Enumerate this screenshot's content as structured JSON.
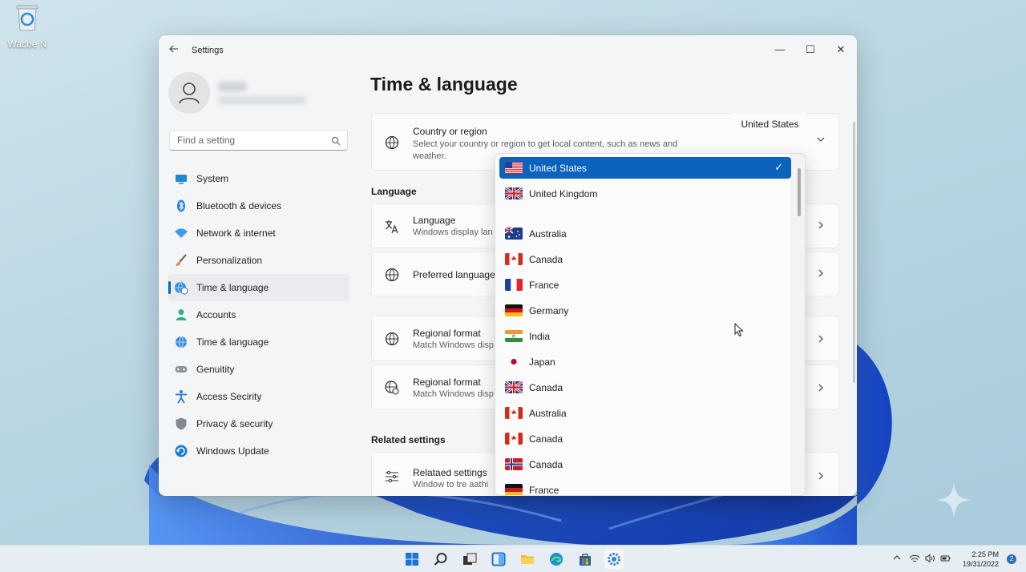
{
  "desktop": {
    "icon_label": "Wacbe N"
  },
  "window": {
    "title": "Settings",
    "controls": {
      "minimize": "—",
      "maximize": "☐",
      "close": "✕"
    }
  },
  "sidebar": {
    "search_placeholder": "Find a setting",
    "items": [
      {
        "label": "System",
        "icon": "monitor-icon"
      },
      {
        "label": "Bluetooth & devices",
        "icon": "bluetooth-icon"
      },
      {
        "label": "Network & internet",
        "icon": "wifi-icon"
      },
      {
        "label": "Personalization",
        "icon": "brush-icon"
      },
      {
        "label": "Time & language",
        "icon": "globe-clock-icon",
        "active": true
      },
      {
        "label": "Accounts",
        "icon": "person-icon"
      },
      {
        "label": "Time & language",
        "icon": "globe-clock-icon"
      },
      {
        "label": "Genuitity",
        "icon": "gamepad-icon"
      },
      {
        "label": "Access Secirity",
        "icon": "accessibility-icon"
      },
      {
        "label": "Privacy & security",
        "icon": "shield-icon"
      },
      {
        "label": "Windows Update",
        "icon": "update-icon"
      }
    ]
  },
  "main": {
    "title": "Time & language",
    "country_card": {
      "title": "Country or region",
      "subtitle": "Select your country or region to get local content, such as news and weather.",
      "value": "United States"
    },
    "language_section": "Language",
    "language_card": {
      "title": "Language",
      "subtitle": "Windows display lan"
    },
    "preferred_card": {
      "title": "Preferred language"
    },
    "regional_card_1": {
      "title": "Regional format",
      "subtitle": "Match Windows disp"
    },
    "regional_card_2": {
      "title": "Regional format",
      "subtitle": "Match Windows disp"
    },
    "related_section": "Related settings",
    "related_card": {
      "title": "Relataed settings",
      "subtitle": "Window to tre aathi"
    }
  },
  "dropdown": {
    "options": [
      {
        "label": "United States",
        "flag": "us",
        "selected": true
      },
      {
        "label": "United Kingdom",
        "flag": "gb"
      },
      {
        "label": "Australia",
        "flag": "au"
      },
      {
        "label": "Canada",
        "flag": "ca"
      },
      {
        "label": "France",
        "flag": "fr"
      },
      {
        "label": "Germany",
        "flag": "de"
      },
      {
        "label": "India",
        "flag": "in"
      },
      {
        "label": "Japan",
        "flag": "jp"
      },
      {
        "label": "Canada",
        "flag": "gb"
      },
      {
        "label": "Australia",
        "flag": "ca"
      },
      {
        "label": "Canada",
        "flag": "ca"
      },
      {
        "label": "Canada",
        "flag": "no"
      },
      {
        "label": "France",
        "flag": "de"
      }
    ],
    "check_glyph": "✓"
  },
  "taskbar": {
    "icons": [
      "start-icon",
      "search-icon",
      "task-view-icon",
      "widgets-icon",
      "file-explorer-icon",
      "edge-icon",
      "store-icon",
      "settings-icon"
    ],
    "time": "2:25 PM",
    "date": "19/31/2022",
    "notification_count": "2"
  },
  "colors": {
    "accent": "#0a63bd",
    "window_bg": "#f3f5f7"
  }
}
